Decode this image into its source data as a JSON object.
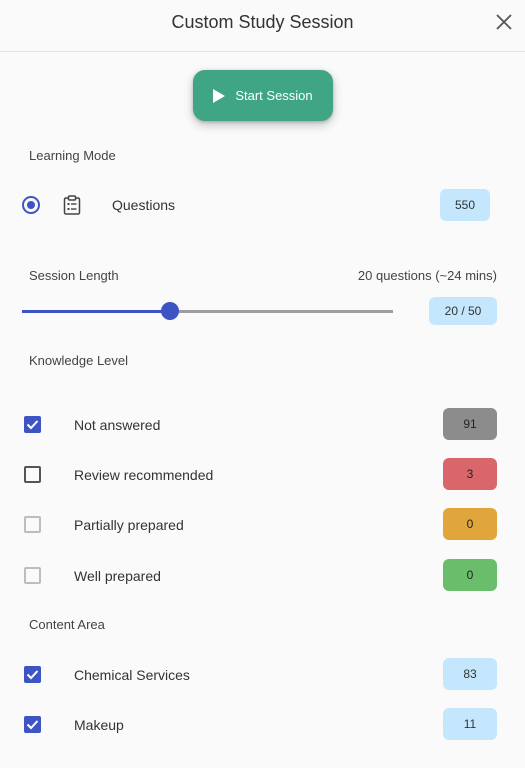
{
  "header": {
    "title": "Custom Study Session",
    "close_icon": "close-icon"
  },
  "start_button": {
    "label": "Start Session",
    "icon": "play-icon",
    "color": "#3fa584"
  },
  "learning_mode": {
    "label": "Learning Mode",
    "option": {
      "label": "Questions",
      "count": "550",
      "selected": true,
      "icon": "clipboard-list-icon"
    }
  },
  "session_length": {
    "label": "Session Length",
    "summary": "20 questions (~24 mins)",
    "value": 20,
    "max": 50,
    "badge": "20 / 50"
  },
  "knowledge_level": {
    "label": "Knowledge Level",
    "items": [
      {
        "label": "Not answered",
        "count": "91",
        "checked": true,
        "color": "#8c8c8c"
      },
      {
        "label": "Review recommended",
        "count": "3",
        "checked": false,
        "color": "#d9666a"
      },
      {
        "label": "Partially prepared",
        "count": "0",
        "checked": false,
        "color": "#e0a63c"
      },
      {
        "label": "Well prepared",
        "count": "0",
        "checked": false,
        "color": "#6abd6b"
      }
    ]
  },
  "content_area": {
    "label": "Content Area",
    "items": [
      {
        "label": "Chemical Services",
        "count": "83",
        "checked": true
      },
      {
        "label": "Makeup",
        "count": "11",
        "checked": true
      }
    ]
  },
  "colors": {
    "accent": "#3d55c4",
    "badge_blue": "#c5e7fd"
  }
}
